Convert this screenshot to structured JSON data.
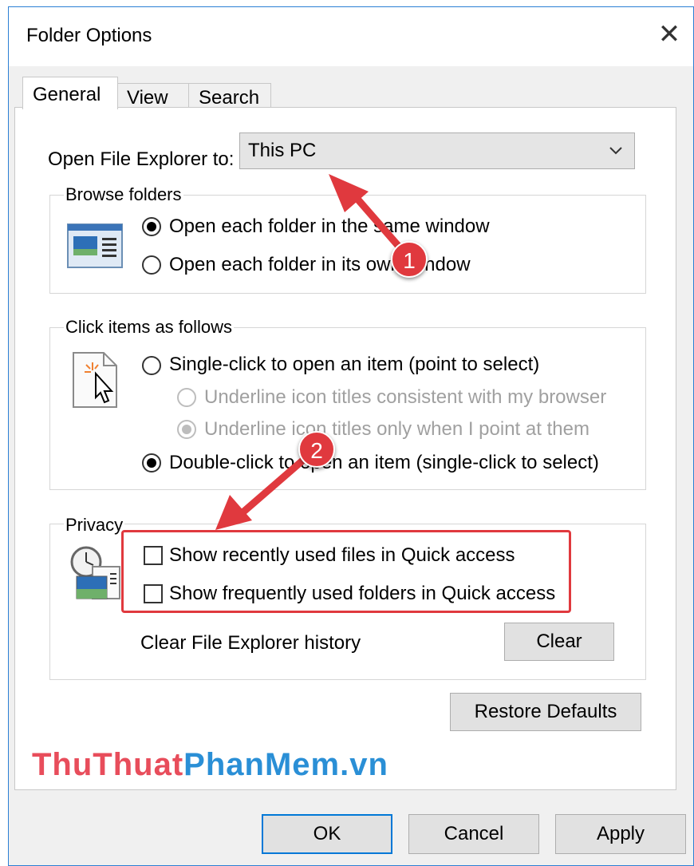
{
  "window": {
    "title": "Folder Options"
  },
  "tabs": [
    "General",
    "View",
    "Search"
  ],
  "open_explorer": {
    "label": "Open File Explorer to:",
    "value": "This PC"
  },
  "browse": {
    "title": "Browse folders",
    "options": [
      "Open each folder in the same window",
      "Open each folder in its own window"
    ]
  },
  "click": {
    "title": "Click items as follows",
    "single": "Single-click to open an item (point to select)",
    "sub_options": [
      "Underline icon titles consistent with my browser",
      "Underline icon titles only when I point at them"
    ],
    "double": "Double-click to open an item (single-click to select)"
  },
  "privacy": {
    "title": "Privacy",
    "checks": [
      "Show recently used files in Quick access",
      "Show frequently used folders in Quick access"
    ],
    "clear_label": "Clear File Explorer history",
    "clear_button": "Clear"
  },
  "buttons": {
    "restore": "Restore Defaults",
    "ok": "OK",
    "cancel": "Cancel",
    "apply": "Apply"
  },
  "annotations": {
    "one": "1",
    "two": "2"
  },
  "watermark": {
    "part1": "ThuThuat",
    "part2": "PhanMem.vn"
  },
  "colors": {
    "annotation_red": "#e0393e",
    "accent_blue": "#0078d7"
  }
}
